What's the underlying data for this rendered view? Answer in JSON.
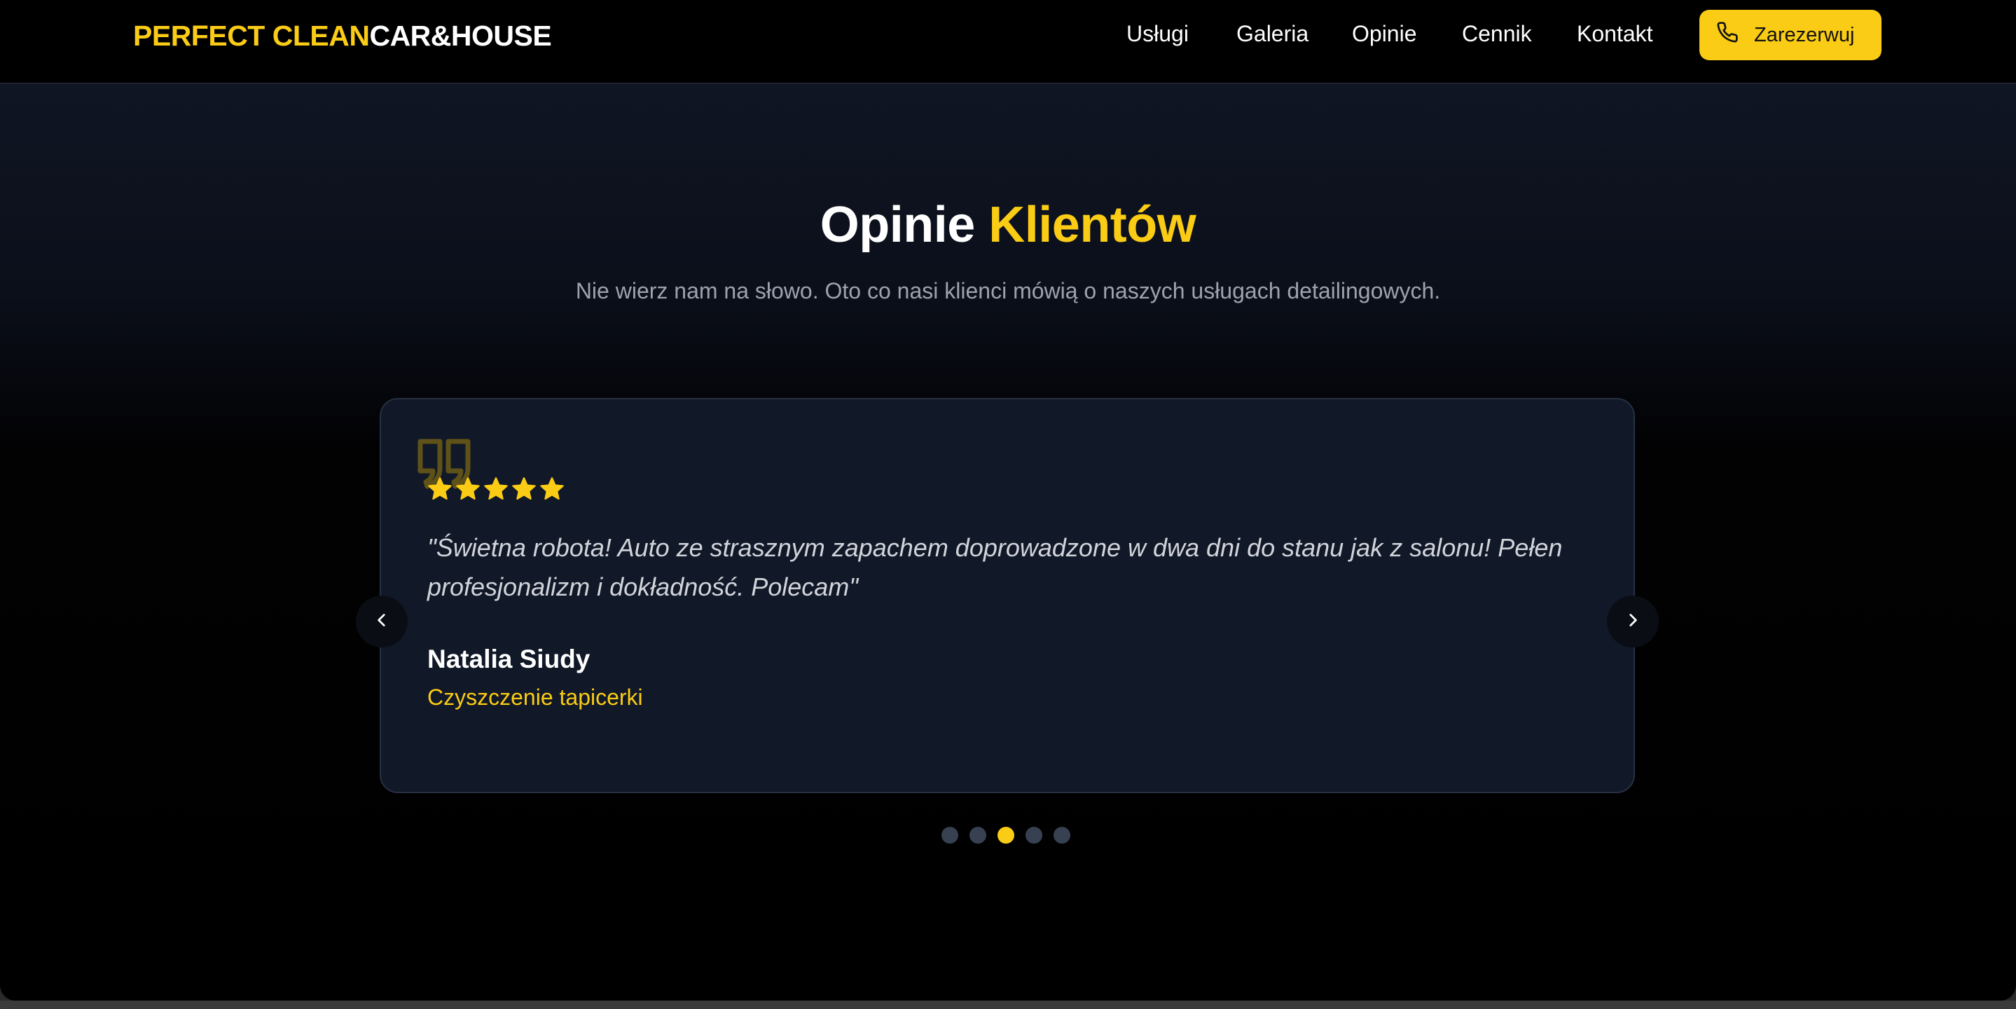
{
  "header": {
    "logo_part1": "PERFECT CLEAN",
    "logo_part2": "CAR&HOUSE",
    "nav": [
      "Usługi",
      "Galeria",
      "Opinie",
      "Cennik",
      "Kontakt"
    ],
    "cta_label": "Zarezerwuj",
    "cta_icon": "phone-icon"
  },
  "section": {
    "title_part1": "Opinie",
    "title_part2": "Klientów",
    "subtitle": "Nie wierz nam na słowo. Oto co nasi klienci mówią o naszych usługach detailingowych."
  },
  "testimonial": {
    "rating": 5,
    "rating_max": 5,
    "text": "\"Świetna robota! Auto ze strasznym zapachem doprowadzone w dwa dni do stanu jak z salonu! Pełen profesjonalizm i dokładność. Polecam\"",
    "author": "Natalia Siudy",
    "service": "Czyszczenie tapicerki"
  },
  "carousel": {
    "total_slides": 5,
    "active_slide": 3
  },
  "colors": {
    "accent": "#facc15",
    "background": "#000000",
    "card": "#111827",
    "muted_text": "#9ca3af"
  }
}
